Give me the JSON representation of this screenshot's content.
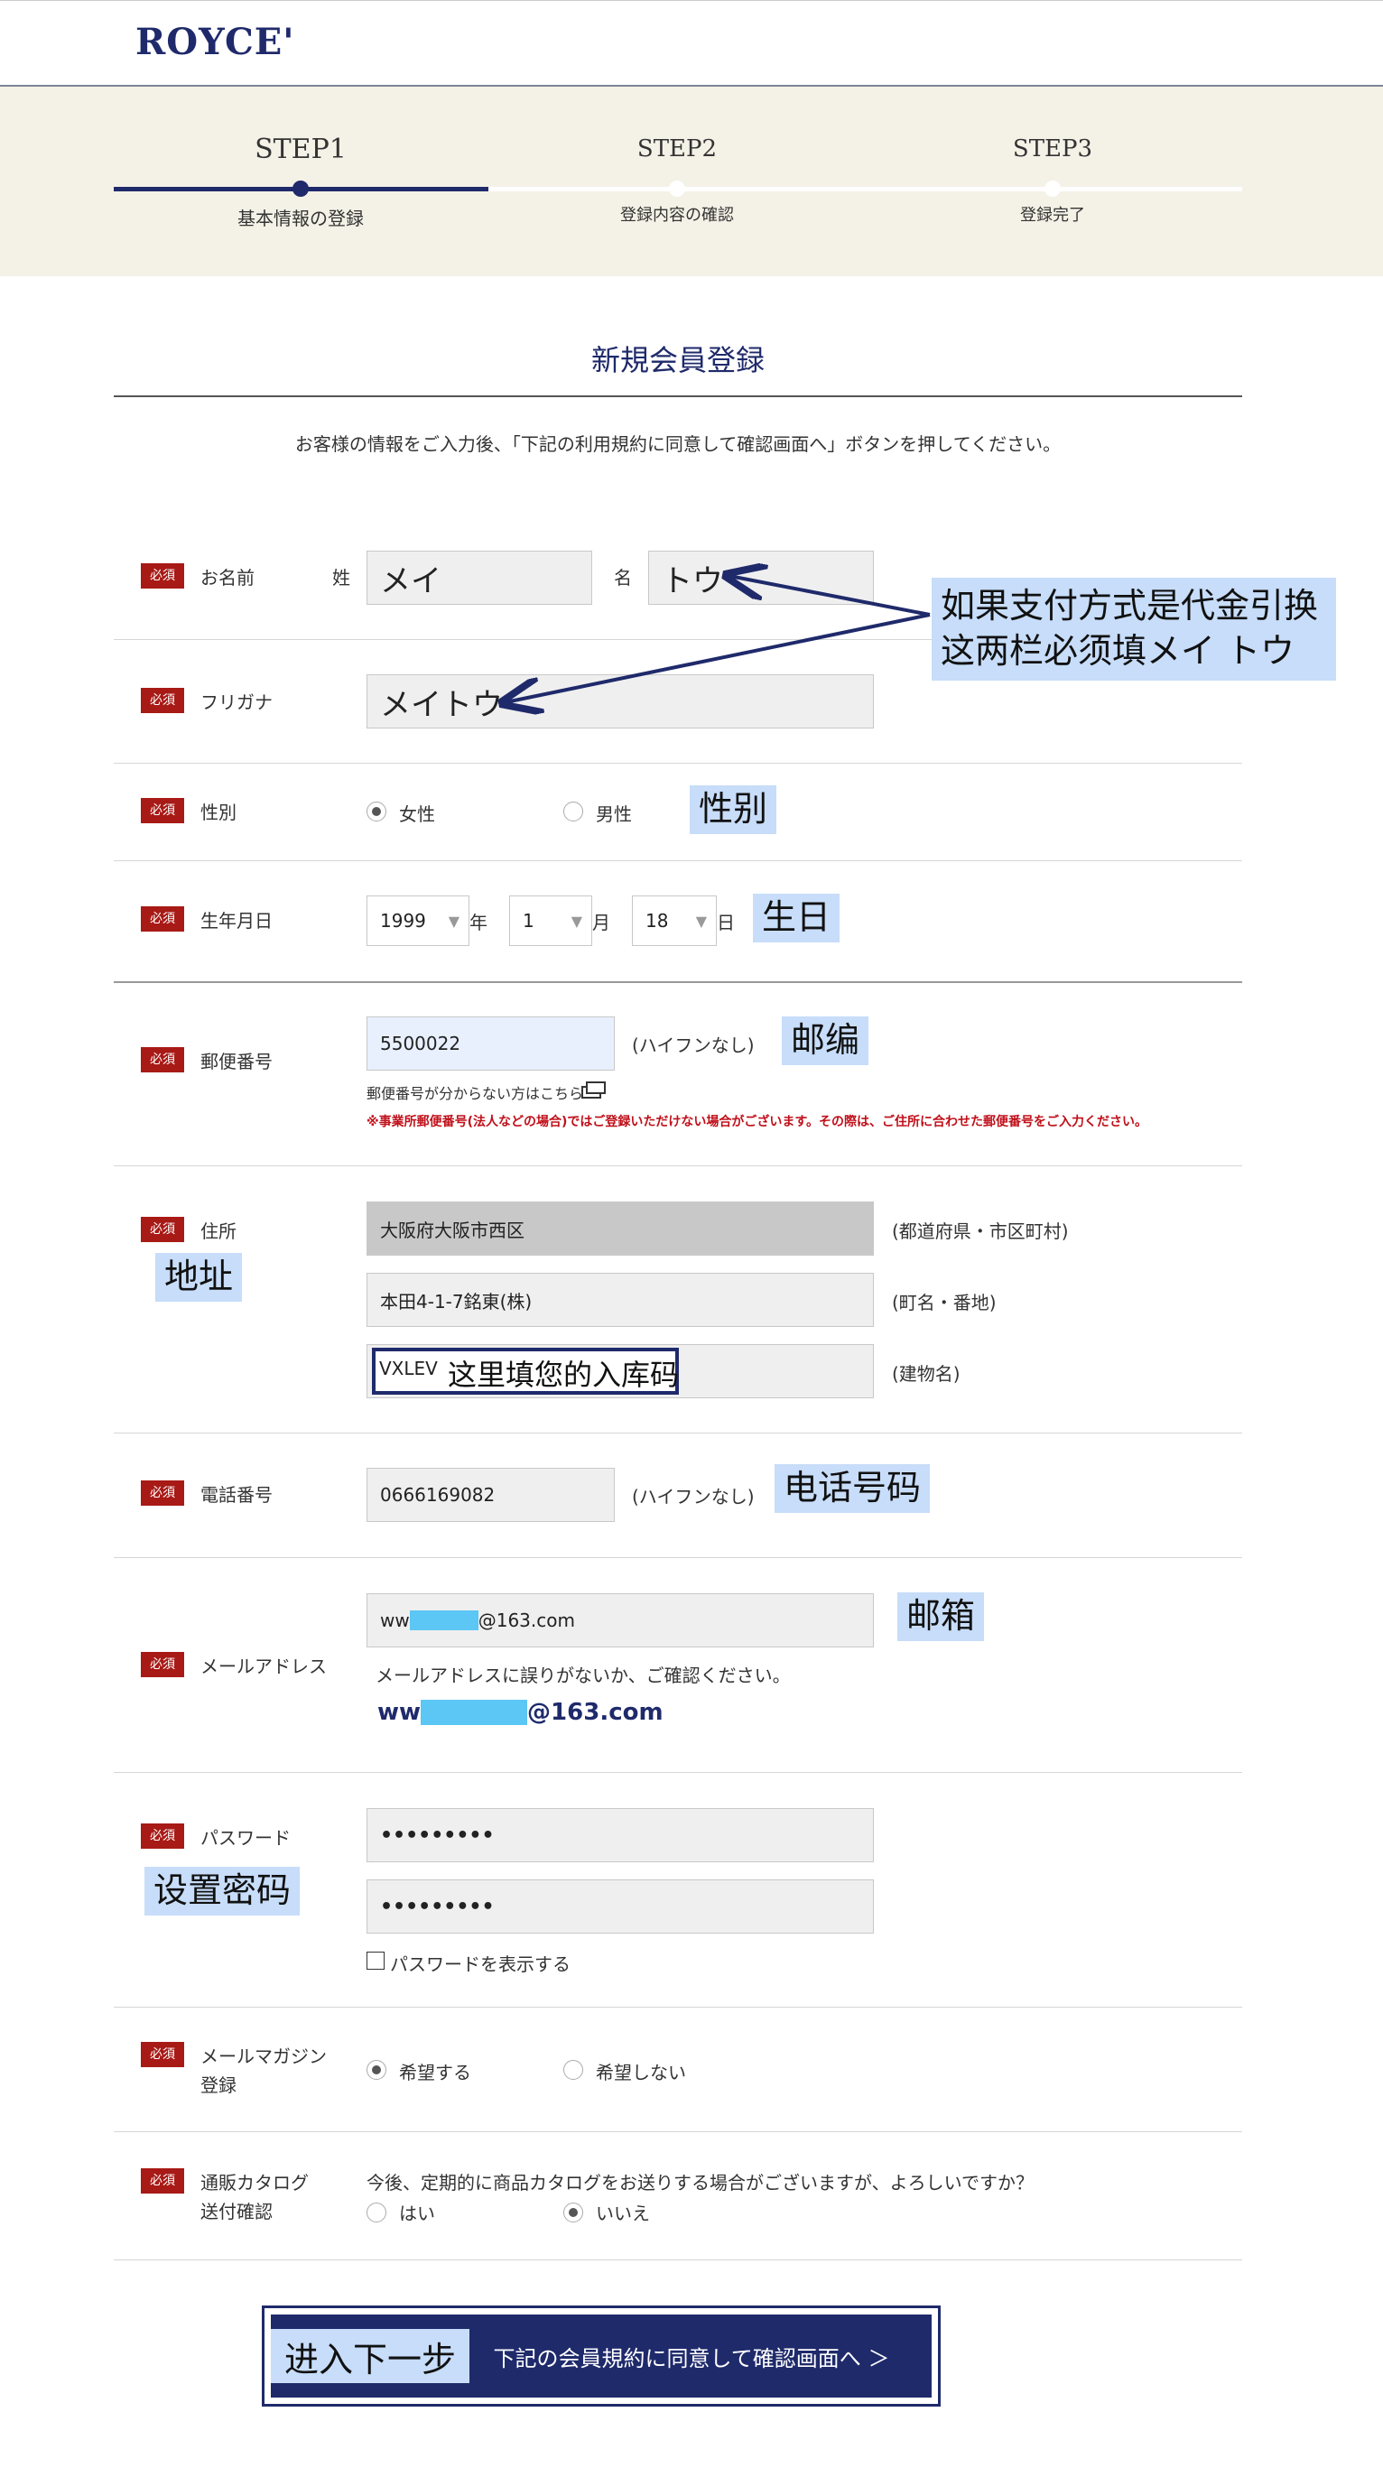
{
  "header": {
    "logo": "ROYCE'"
  },
  "steps": [
    {
      "label": "STEP1",
      "sub": "基本情報の登録",
      "active": true
    },
    {
      "label": "STEP2",
      "sub": "登録内容の確認",
      "active": false
    },
    {
      "label": "STEP3",
      "sub": "登録完了",
      "active": false
    }
  ],
  "page": {
    "title": "新規会員登録",
    "intro": "お客様の情報をご入力後、「下記の利用規約に同意して確認画面へ」ボタンを押してください。",
    "required_badge": "必須"
  },
  "name": {
    "label": "お名前",
    "sei_label": "姓",
    "sei_value": "メイ",
    "mei_label": "名",
    "mei_value": "トウ"
  },
  "furigana": {
    "label": "フリガナ",
    "value": "メイトウ"
  },
  "gender": {
    "label": "性別",
    "options": [
      "女性",
      "男性"
    ],
    "selected": "女性"
  },
  "birth": {
    "label": "生年月日",
    "year": "1999",
    "year_unit": "年",
    "month": "1",
    "month_unit": "月",
    "day": "18",
    "day_unit": "日"
  },
  "postal": {
    "label": "郵便番号",
    "value": "5500022",
    "note": "(ハイフンなし)",
    "help_link": "郵便番号が分からない方はこちら",
    "warning": "※事業所郵便番号(法人などの場合)ではご登録いただけない場合がございます。その際は、ご住所に合わせた郵便番号をご入力ください。"
  },
  "address": {
    "label": "住所",
    "line1": "大阪府大阪市西区",
    "line1_note": "(都道府県・市区町村)",
    "line2": "本田4-1-7銘東(株)",
    "line2_note": "(町名・番地)",
    "line3": "VXLEV",
    "line3_note": "(建物名)"
  },
  "phone": {
    "label": "電話番号",
    "value": "0666169082",
    "note": "(ハイフンなし)"
  },
  "email": {
    "label": "メールアドレス",
    "prefix": "ww",
    "suffix": "@163.com",
    "confirm_text": "メールアドレスに誤りがないか、ご確認ください。"
  },
  "password": {
    "label": "パスワード",
    "value1": "•••••••••",
    "value2": "•••••••••",
    "show_label": "パスワードを表示する"
  },
  "magazine": {
    "label_line1": "メールマガジン",
    "label_line2": "登録",
    "options": [
      "希望する",
      "希望しない"
    ],
    "selected": "希望する"
  },
  "catalog": {
    "label_line1": "通販カタログ",
    "label_line2": "送付確認",
    "question": "今後、定期的に商品カタログをお送りする場合がございますが、よろしいですか？",
    "options": [
      "はい",
      "いいえ"
    ],
    "selected": "いいえ"
  },
  "submit": {
    "label": "下記の会員規約に同意して確認画面へ ＞"
  },
  "annotations": {
    "name_note_line1": "如果支付方式是代金引换",
    "name_note_line2": "这两栏必须填メイ トウ",
    "gender": "性别",
    "birth": "生日",
    "postal": "邮编",
    "address": "地址",
    "building": "这里填您的入库码",
    "phone": "电话号码",
    "email": "邮箱",
    "password": "设置密码",
    "next": "进入下一步"
  },
  "colors": {
    "navy": "#1f2a6b",
    "required_red": "#a81a16",
    "annotation_blue": "#c7ddf9",
    "step_bg": "#f4f1e6"
  }
}
